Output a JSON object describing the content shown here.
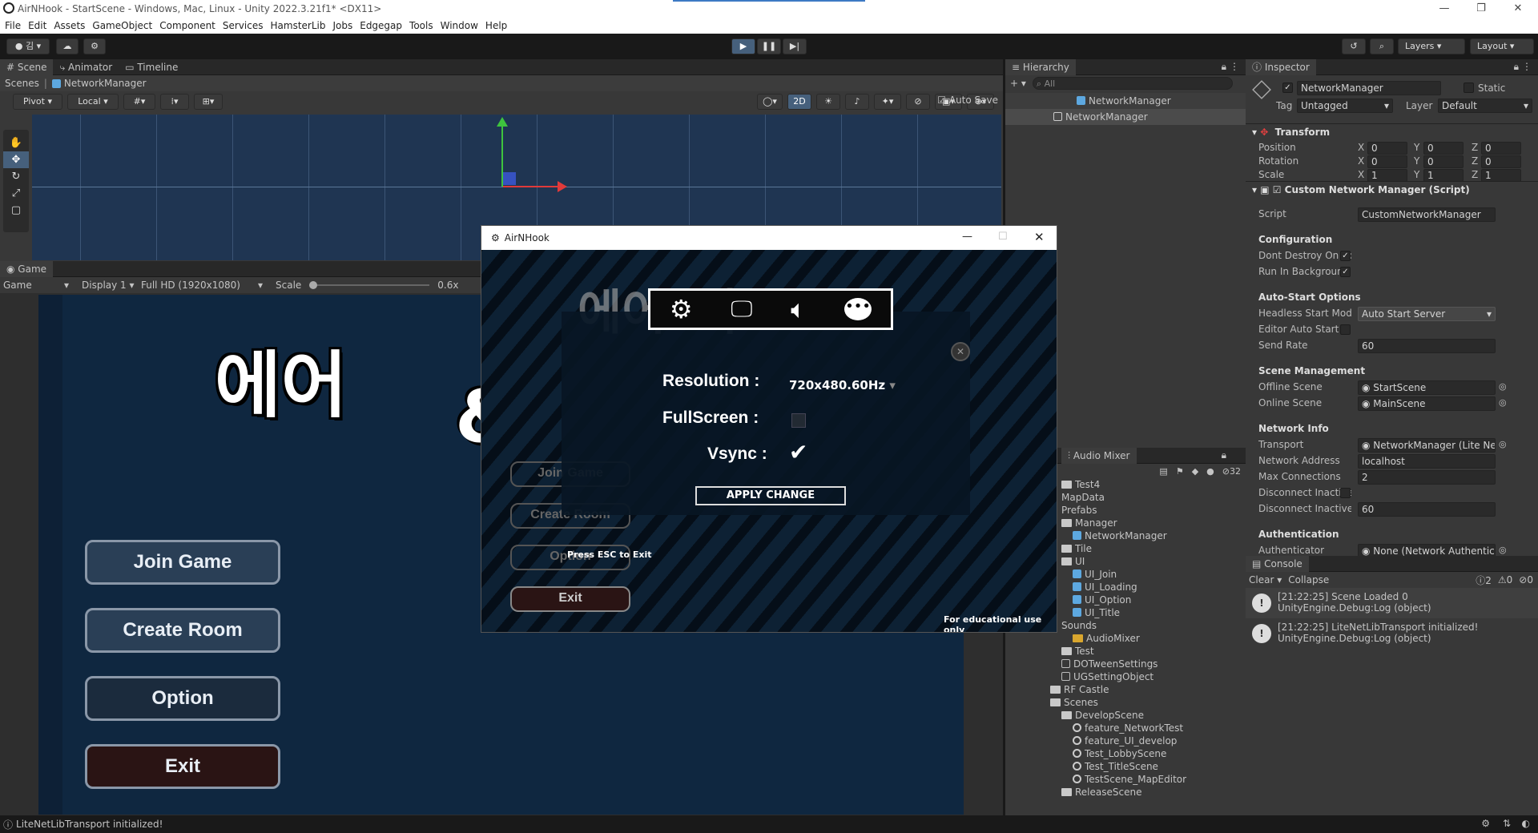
{
  "window": {
    "title": "AirNHook - StartScene - Windows, Mac, Linux - Unity 2022.3.21f1* <DX11>",
    "minimize": "—",
    "maximize": "❐",
    "close": "✕"
  },
  "menu": [
    "File",
    "Edit",
    "Assets",
    "GameObject",
    "Component",
    "Services",
    "HamsterLib",
    "Jobs",
    "Edgegap",
    "Tools",
    "Window",
    "Help"
  ],
  "toolbar": {
    "account_label": "김",
    "layers": "Layers",
    "layout": "Layout"
  },
  "scene_panel": {
    "tabs": [
      "Scene",
      "Animator",
      "Timeline"
    ],
    "breadcrumb_root": "Scenes",
    "breadcrumb_item": "NetworkManager",
    "auto_save": "Auto Save",
    "pivot": "Pivot",
    "local": "Local",
    "mode_2d": "2D"
  },
  "game_panel": {
    "tab": "Game",
    "mode": "Game",
    "display": "Display 1",
    "resolution": "Full HD (1920x1080)",
    "scale_label": "Scale",
    "scale_value": "0.6x",
    "logo_text": "에어",
    "logo_tail": "&",
    "buttons": [
      "Join Game",
      "Create Room",
      "Option",
      "Exit"
    ]
  },
  "popup": {
    "title": "AirNHook",
    "logo_text": "에어&후크",
    "bg_buttons": [
      "Join Game",
      "Create Room",
      "Option",
      "Exit"
    ],
    "press_esc": "Press ESC to Exit",
    "footer": "For educational use only",
    "options": {
      "resolution_label": "Resolution :",
      "resolution_value": "720x480.60Hz",
      "fullscreen_label": "FullScreen :",
      "fullscreen_checked": false,
      "vsync_label": "Vsync :",
      "vsync_checked": true,
      "apply": "APPLY CHANGE"
    },
    "tab_icons": [
      "gear-icon",
      "monitor-icon",
      "speaker-icon",
      "chat-icon"
    ]
  },
  "hierarchy": {
    "tab": "Hierarchy",
    "search_placeholder": "All",
    "root": "NetworkManager",
    "child": "NetworkManager"
  },
  "audio_mixer": {
    "tab": "Audio Mixer",
    "count": "32"
  },
  "project_tree": [
    {
      "label": "Test4",
      "icon": "folder",
      "indent": 0
    },
    {
      "label": "MapData",
      "icon": "none",
      "indent": 0
    },
    {
      "label": "Prefabs",
      "icon": "none",
      "indent": 0
    },
    {
      "label": "Manager",
      "icon": "folder",
      "indent": 0
    },
    {
      "label": "NetworkManager",
      "icon": "cube",
      "indent": 1
    },
    {
      "label": "Tile",
      "icon": "folder",
      "indent": 0
    },
    {
      "label": "UI",
      "icon": "folder",
      "indent": 0
    },
    {
      "label": "UI_Join",
      "icon": "cube",
      "indent": 1
    },
    {
      "label": "UI_Loading",
      "icon": "cube",
      "indent": 1
    },
    {
      "label": "UI_Option",
      "icon": "cube",
      "indent": 1
    },
    {
      "label": "UI_Title",
      "icon": "cube",
      "indent": 1
    },
    {
      "label": "Sounds",
      "icon": "none",
      "indent": 0
    },
    {
      "label": "AudioMixer",
      "icon": "mixer",
      "indent": 1
    },
    {
      "label": "Test",
      "icon": "folder",
      "indent": 0
    },
    {
      "label": "DOTweenSettings",
      "icon": "asset",
      "indent": 0
    },
    {
      "label": "UGSettingObject",
      "icon": "asset",
      "indent": 0
    },
    {
      "label": "RF Castle",
      "icon": "folder",
      "indent": -1
    },
    {
      "label": "Scenes",
      "icon": "folder",
      "indent": -1
    },
    {
      "label": "DevelopScene",
      "icon": "folder",
      "indent": 0
    },
    {
      "label": "feature_NetworkTest",
      "icon": "scene",
      "indent": 1
    },
    {
      "label": "feature_UI_develop",
      "icon": "scene",
      "indent": 1
    },
    {
      "label": "Test_LobbyScene",
      "icon": "scene",
      "indent": 1
    },
    {
      "label": "Test_TitleScene",
      "icon": "scene",
      "indent": 1
    },
    {
      "label": "TestScene_MapEditor",
      "icon": "scene",
      "indent": 1
    },
    {
      "label": "ReleaseScene",
      "icon": "folder",
      "indent": 0
    }
  ],
  "inspector": {
    "tab": "Inspector",
    "object_name": "NetworkManager",
    "static": "Static",
    "tag_label": "Tag",
    "tag_value": "Untagged",
    "layer_label": "Layer",
    "layer_value": "Default",
    "transform": {
      "title": "Transform",
      "rows": [
        {
          "label": "Position",
          "x": "0",
          "y": "0",
          "z": "0"
        },
        {
          "label": "Rotation",
          "x": "0",
          "y": "0",
          "z": "0"
        },
        {
          "label": "Scale",
          "x": "1",
          "y": "1",
          "z": "1"
        }
      ]
    },
    "script_component": {
      "title": "Custom Network Manager (Script)",
      "script_label": "Script",
      "script_value": "CustomNetworkManager",
      "configuration": "Configuration",
      "dont_destroy": "Dont Destroy On Loa",
      "run_in_bg": "Run In Background",
      "auto_start": "Auto-Start Options",
      "headless_label": "Headless Start Mode",
      "headless_value": "Auto Start Server",
      "editor_auto": "Editor Auto Start",
      "send_rate_label": "Send Rate",
      "send_rate_value": "60",
      "scene_mgmt": "Scene Management",
      "offline_label": "Offline Scene",
      "offline_value": "StartScene",
      "online_label": "Online Scene",
      "online_value": "MainScene",
      "network_info": "Network Info",
      "transport_label": "Transport",
      "transport_value": "NetworkManager (Lite Net Lib",
      "address_label": "Network Address",
      "address_value": "localhost",
      "maxconn_label": "Max Connections",
      "maxconn_value": "2",
      "disc1_label": "Disconnect Inactive C",
      "disc2_label": "Disconnect Inactive T",
      "disc2_value": "60",
      "auth": "Authentication",
      "authenticator_label": "Authenticator",
      "authenticator_value": "None (Network Authenticator)"
    }
  },
  "console": {
    "tab": "Console",
    "clear": "Clear",
    "collapse": "Collapse",
    "counts": [
      "2",
      "0",
      "0"
    ],
    "entries": [
      {
        "line1": "[21:22:25] Scene Loaded 0",
        "line2": "UnityEngine.Debug:Log (object)"
      },
      {
        "line1": "[21:22:25] LiteNetLibTransport initialized!",
        "line2": "UnityEngine.Debug:Log (object)"
      }
    ]
  },
  "status": "LiteNetLibTransport initialized!"
}
